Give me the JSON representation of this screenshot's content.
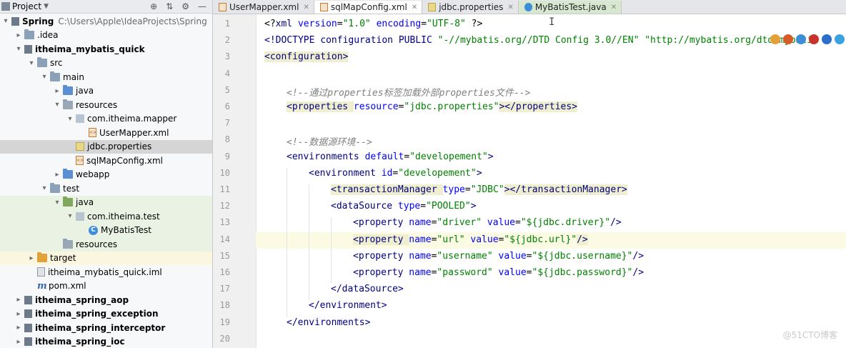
{
  "project": {
    "title": "Project",
    "tree": [
      {
        "label": "Spring",
        "extra": "C:\\Users\\Apple\\IdeaProjects\\Spring",
        "indent": 0,
        "arrow": "down",
        "icon": "module",
        "bold": true
      },
      {
        "label": ".idea",
        "indent": 1,
        "arrow": "right",
        "icon": "folder"
      },
      {
        "label": "itheima_mybatis_quick",
        "indent": 1,
        "arrow": "down",
        "icon": "module",
        "bold": true
      },
      {
        "label": "src",
        "indent": 2,
        "arrow": "down",
        "icon": "folder"
      },
      {
        "label": "main",
        "indent": 3,
        "arrow": "down",
        "icon": "folder"
      },
      {
        "label": "java",
        "indent": 4,
        "arrow": "right",
        "icon": "folder-blue"
      },
      {
        "label": "resources",
        "indent": 4,
        "arrow": "down",
        "icon": "folder-res"
      },
      {
        "label": "com.itheima.mapper",
        "indent": 5,
        "arrow": "down",
        "icon": "package"
      },
      {
        "label": "UserMapper.xml",
        "indent": 6,
        "arrow": "",
        "icon": "xml"
      },
      {
        "label": "jdbc.properties",
        "indent": 5,
        "arrow": "",
        "icon": "properties",
        "selected": true
      },
      {
        "label": "sqlMapConfig.xml",
        "indent": 5,
        "arrow": "",
        "icon": "xml"
      },
      {
        "label": "webapp",
        "indent": 4,
        "arrow": "right",
        "icon": "folder-blue"
      },
      {
        "label": "test",
        "indent": 3,
        "arrow": "down",
        "icon": "folder"
      },
      {
        "label": "java",
        "indent": 4,
        "arrow": "down",
        "icon": "folder-green",
        "test": true
      },
      {
        "label": "com.itheima.test",
        "indent": 5,
        "arrow": "down",
        "icon": "package",
        "test": true
      },
      {
        "label": "MyBatisTest",
        "indent": 6,
        "arrow": "",
        "icon": "class",
        "test": true
      },
      {
        "label": "resources",
        "indent": 4,
        "arrow": "",
        "icon": "folder-res",
        "test": true
      },
      {
        "label": "target",
        "indent": 2,
        "arrow": "right",
        "icon": "folder-orange",
        "target": true
      },
      {
        "label": "itheima_mybatis_quick.iml",
        "indent": 2,
        "arrow": "",
        "icon": "iml"
      },
      {
        "label": "pom.xml",
        "indent": 2,
        "arrow": "",
        "icon": "maven"
      },
      {
        "label": "itheima_spring_aop",
        "indent": 1,
        "arrow": "right",
        "icon": "module",
        "bold": true
      },
      {
        "label": "itheima_spring_exception",
        "indent": 1,
        "arrow": "right",
        "icon": "module",
        "bold": true
      },
      {
        "label": "itheima_spring_interceptor",
        "indent": 1,
        "arrow": "right",
        "icon": "module",
        "bold": true
      },
      {
        "label": "itheima_spring_ioc",
        "indent": 1,
        "arrow": "right",
        "icon": "module",
        "bold": true
      }
    ]
  },
  "tabs": [
    {
      "label": "UserMapper.xml",
      "icon": "xml",
      "active": false
    },
    {
      "label": "sqlMapConfig.xml",
      "icon": "xml",
      "active": true
    },
    {
      "label": "jdbc.properties",
      "icon": "properties",
      "active": false
    },
    {
      "label": "MyBatisTest.java",
      "icon": "class",
      "active": false,
      "green": true
    }
  ],
  "editor": {
    "current_line": 14,
    "lines": [
      {
        "n": "1",
        "indent": 0,
        "seg": [
          [
            "p",
            "<"
          ],
          [
            "p",
            "?"
          ],
          [
            "t",
            "xml "
          ],
          [
            "a",
            "version"
          ],
          [
            "p",
            "="
          ],
          [
            "v",
            "\"1.0\""
          ],
          [
            "p",
            " "
          ],
          [
            "a",
            "encoding"
          ],
          [
            "p",
            "="
          ],
          [
            "v",
            "\"UTF-8\""
          ],
          [
            "p",
            " ?>"
          ]
        ]
      },
      {
        "n": "2",
        "indent": 0,
        "seg": [
          [
            "t",
            "<!DOCTYPE configuration PUBLIC "
          ],
          [
            "v",
            "\"-//mybatis.org//DTD Config 3.0//EN\""
          ],
          [
            "p",
            " "
          ],
          [
            "v",
            "\"http://mybatis.org/dtd/mybatis"
          ]
        ]
      },
      {
        "n": "3",
        "indent": 0,
        "seg": [
          [
            "tb",
            "<configuration>"
          ]
        ]
      },
      {
        "n": "4",
        "indent": 0,
        "seg": []
      },
      {
        "n": "5",
        "indent": 1,
        "seg": [
          [
            "c",
            "<!--通过properties标签加载外部properties文件-->"
          ]
        ]
      },
      {
        "n": "6",
        "indent": 1,
        "seg": [
          [
            "tb",
            "<properties "
          ],
          [
            "a",
            "resource"
          ],
          [
            "p",
            "="
          ],
          [
            "v",
            "\"jdbc.properties\""
          ],
          [
            "tb",
            "></properties>"
          ]
        ]
      },
      {
        "n": "7",
        "indent": 0,
        "seg": []
      },
      {
        "n": "8",
        "indent": 1,
        "seg": [
          [
            "c",
            "<!--数据源环境-->"
          ]
        ]
      },
      {
        "n": "9",
        "indent": 1,
        "seg": [
          [
            "t",
            "<environments "
          ],
          [
            "a",
            "default"
          ],
          [
            "p",
            "="
          ],
          [
            "v",
            "\"developement\""
          ],
          [
            "t",
            ">"
          ]
        ]
      },
      {
        "n": "10",
        "indent": 2,
        "seg": [
          [
            "t",
            "<environment "
          ],
          [
            "a",
            "id"
          ],
          [
            "p",
            "="
          ],
          [
            "v",
            "\"developement\""
          ],
          [
            "t",
            ">"
          ]
        ]
      },
      {
        "n": "11",
        "indent": 3,
        "seg": [
          [
            "tb",
            "<transactionManager "
          ],
          [
            "a",
            "type"
          ],
          [
            "p",
            "="
          ],
          [
            "v",
            "\"JDBC\""
          ],
          [
            "tb",
            "></transactionManager>"
          ]
        ]
      },
      {
        "n": "12",
        "indent": 3,
        "seg": [
          [
            "t",
            "<dataSource "
          ],
          [
            "a",
            "type"
          ],
          [
            "p",
            "="
          ],
          [
            "v",
            "\"POOLED\""
          ],
          [
            "t",
            ">"
          ]
        ]
      },
      {
        "n": "13",
        "indent": 4,
        "seg": [
          [
            "t",
            "<property "
          ],
          [
            "a",
            "name"
          ],
          [
            "p",
            "="
          ],
          [
            "v",
            "\"driver\""
          ],
          [
            "p",
            " "
          ],
          [
            "a",
            "value"
          ],
          [
            "p",
            "="
          ],
          [
            "v",
            "\"${jdbc.driver}\""
          ],
          [
            "t",
            "/>"
          ]
        ]
      },
      {
        "n": "14",
        "indent": 4,
        "seg": [
          [
            "tb",
            "<property "
          ],
          [
            "a",
            "name"
          ],
          [
            "p",
            "="
          ],
          [
            "v",
            "\"url\""
          ],
          [
            "p",
            " "
          ],
          [
            "a",
            "value"
          ],
          [
            "p",
            "="
          ],
          [
            "v",
            "\"${jdbc.url}\""
          ],
          [
            "tb",
            "/>"
          ]
        ]
      },
      {
        "n": "15",
        "indent": 4,
        "seg": [
          [
            "t",
            "<property "
          ],
          [
            "a",
            "name"
          ],
          [
            "p",
            "="
          ],
          [
            "v",
            "\"username\""
          ],
          [
            "p",
            " "
          ],
          [
            "a",
            "value"
          ],
          [
            "p",
            "="
          ],
          [
            "v",
            "\"${jdbc.username}\""
          ],
          [
            "t",
            "/>"
          ]
        ]
      },
      {
        "n": "16",
        "indent": 4,
        "seg": [
          [
            "t",
            "<property "
          ],
          [
            "a",
            "name"
          ],
          [
            "p",
            "="
          ],
          [
            "v",
            "\"password\""
          ],
          [
            "p",
            " "
          ],
          [
            "a",
            "value"
          ],
          [
            "p",
            "="
          ],
          [
            "v",
            "\"${jdbc.password}\""
          ],
          [
            "t",
            "/>"
          ]
        ]
      },
      {
        "n": "17",
        "indent": 3,
        "seg": [
          [
            "t",
            "</dataSource>"
          ]
        ]
      },
      {
        "n": "18",
        "indent": 2,
        "seg": [
          [
            "t",
            "</environment>"
          ]
        ]
      },
      {
        "n": "19",
        "indent": 1,
        "seg": [
          [
            "t",
            "</environments>"
          ]
        ]
      },
      {
        "n": "20",
        "indent": 0,
        "seg": []
      }
    ]
  },
  "watermark": "@51CTO博客",
  "browser_icons": [
    "chrome-icon",
    "firefox-icon",
    "safari-icon",
    "opera-icon",
    "ie-icon",
    "edge-icon"
  ]
}
